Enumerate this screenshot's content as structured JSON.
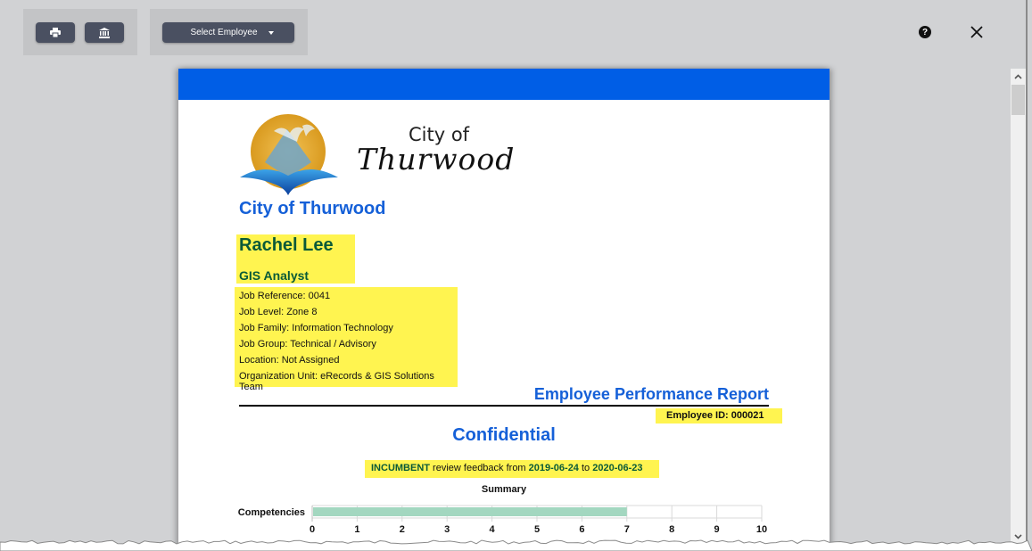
{
  "toolbar": {
    "print_icon": "print-icon",
    "institution_icon": "institution-icon",
    "select_employee_label": "Select Employee",
    "help_icon": "question-circle-icon",
    "close_icon": "close-icon"
  },
  "report": {
    "logo_line1": "City of",
    "logo_line2": "Thurwood",
    "organization": "City of Thurwood",
    "employee_name": "Rachel Lee",
    "employee_title": "GIS Analyst",
    "details": [
      "Job Reference: 0041",
      "Job Level: Zone 8",
      "Job Family: Information Technology",
      "Job Group: Technical / Advisory",
      "Location: Not Assigned",
      "Organization Unit: eRecords & GIS Solutions Team"
    ],
    "report_title": "Employee Performance Report",
    "employee_id": "Employee ID: 000021",
    "confidential": "Confidential",
    "feedback": {
      "reviewer_type": "INCUMBENT",
      "text_mid": " review feedback from ",
      "start_date": "2019-06-24",
      "text_to": " to ",
      "end_date": "2020-06-23"
    }
  },
  "colors": {
    "banner": "#005ee6",
    "heading_blue": "#1560d8",
    "highlight": "#fff450",
    "name_green": "#0a5a38",
    "bar_fill": "#a3d7c0",
    "toolbar_button": "#4a5061"
  },
  "chart_data": {
    "type": "bar",
    "orientation": "horizontal",
    "title": "Summary",
    "categories": [
      "Competencies"
    ],
    "values": [
      7
    ],
    "xlim": [
      0,
      10
    ],
    "xticks": [
      "0",
      "1",
      "2",
      "3",
      "4",
      "5",
      "6",
      "7",
      "8",
      "9",
      "10"
    ],
    "grid": true,
    "xlabel": "",
    "ylabel": ""
  }
}
